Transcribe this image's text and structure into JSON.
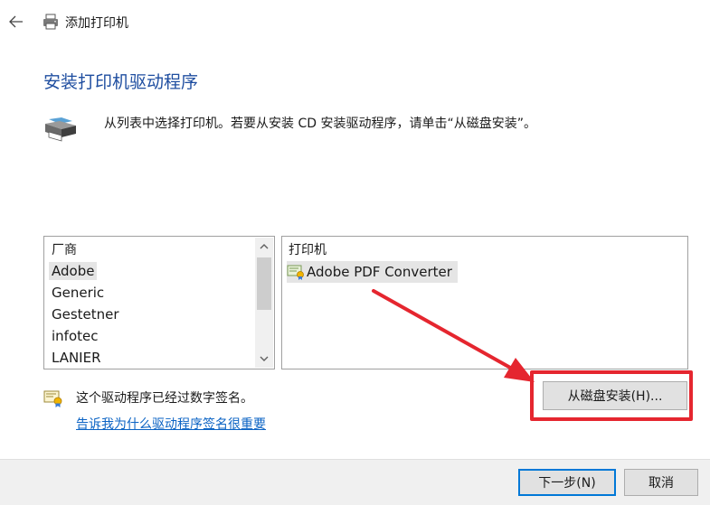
{
  "window": {
    "title": "添加打印机",
    "back_icon": "arrow-left-icon",
    "title_icon": "printer-icon"
  },
  "heading": "安装打印机驱动程序",
  "intro": {
    "icon": "printer-icon",
    "text": "从列表中选择打印机。若要从安装 CD 安装驱动程序，请单击“从磁盘安装”。"
  },
  "manufacturer_list": {
    "header": "厂商",
    "items": [
      {
        "label": "Adobe",
        "selected": true
      },
      {
        "label": "Generic",
        "selected": false
      },
      {
        "label": "Gestetner",
        "selected": false
      },
      {
        "label": "infotec",
        "selected": false
      },
      {
        "label": "LANIER",
        "selected": false
      }
    ]
  },
  "printer_list": {
    "header": "打印机",
    "items": [
      {
        "label": "Adobe PDF Converter",
        "icon": "certified-driver-icon",
        "selected": true
      }
    ]
  },
  "signature_note": {
    "icon": "certificate-icon",
    "text": "这个驱动程序已经过数字签名。",
    "link": "告诉我为什么驱动程序签名很重要"
  },
  "buttons": {
    "have_disk": "从磁盘安装(H)...",
    "next": "下一步(N)",
    "cancel": "取消"
  },
  "annotation": {
    "color": "#e5262f"
  }
}
